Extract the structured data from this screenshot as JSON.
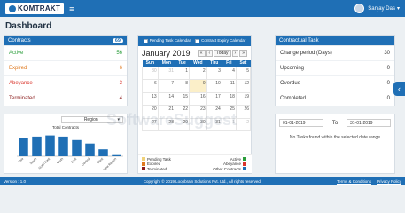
{
  "header": {
    "logo": "KOMTRAKT",
    "user": "Sanjay Das"
  },
  "page": {
    "title": "Dashboard"
  },
  "contracts": {
    "title": "Contracts",
    "count": "69",
    "items": [
      {
        "label": "Active",
        "value": "56",
        "color": "#2a9d3a"
      },
      {
        "label": "Expired",
        "value": "6",
        "color": "#e07a1f"
      },
      {
        "label": "Abeyance",
        "value": "3",
        "color": "#d9342b"
      },
      {
        "label": "Terminated",
        "value": "4",
        "color": "#8b1d1d"
      }
    ]
  },
  "region": {
    "select": "Region",
    "chart_title": "Total Contracts"
  },
  "chart_data": {
    "type": "bar",
    "title": "Total Contracts",
    "categories": [
      "Asia",
      "South",
      "North East",
      "North",
      "East",
      "Central",
      "West",
      "New Region"
    ],
    "values": [
      16,
      17,
      18,
      17,
      14,
      11,
      6,
      1
    ],
    "ylim": [
      0,
      20
    ]
  },
  "calendar": {
    "opt1": "Pending Task Calendar",
    "opt2": "Contract Expiry Calendar",
    "month": "January 2019",
    "today": "Today",
    "days": [
      "Sun",
      "Mon",
      "Tue",
      "Wed",
      "Thu",
      "Fri",
      "Sat"
    ],
    "weeks": [
      [
        "30",
        "31",
        "1",
        "2",
        "3",
        "4",
        "5"
      ],
      [
        "6",
        "7",
        "8",
        "9",
        "10",
        "11",
        "12"
      ],
      [
        "13",
        "14",
        "15",
        "16",
        "17",
        "18",
        "19"
      ],
      [
        "20",
        "21",
        "22",
        "23",
        "24",
        "25",
        "26"
      ],
      [
        "27",
        "28",
        "29",
        "30",
        "31",
        "1",
        "2"
      ]
    ],
    "legend": {
      "pending": "Pending Task",
      "active": "Active",
      "expired": "Expired",
      "abeyance": "Abeyance",
      "terminated": "Terminated",
      "other": "Other Contracts"
    }
  },
  "task": {
    "title": "Contractual Task",
    "items": [
      {
        "label": "Change period (Days)",
        "value": "30"
      },
      {
        "label": "Upcoming",
        "value": "0"
      },
      {
        "label": "Overdue",
        "value": "0"
      },
      {
        "label": "Completed",
        "value": "0"
      }
    ]
  },
  "range": {
    "from": "01-01-2019",
    "to_label": "To",
    "to": "31-01-2019",
    "empty": "No Tasks found within the selected date range"
  },
  "footer": {
    "version": "Version : 1.0",
    "copyright": "Copyright © 2019 Loopbrain Solutions Pvt. Ltd., All rights reserved.",
    "terms": "Terms & Conditions",
    "privacy": "Privacy Policy"
  },
  "watermark": "SoftwareSuggest"
}
